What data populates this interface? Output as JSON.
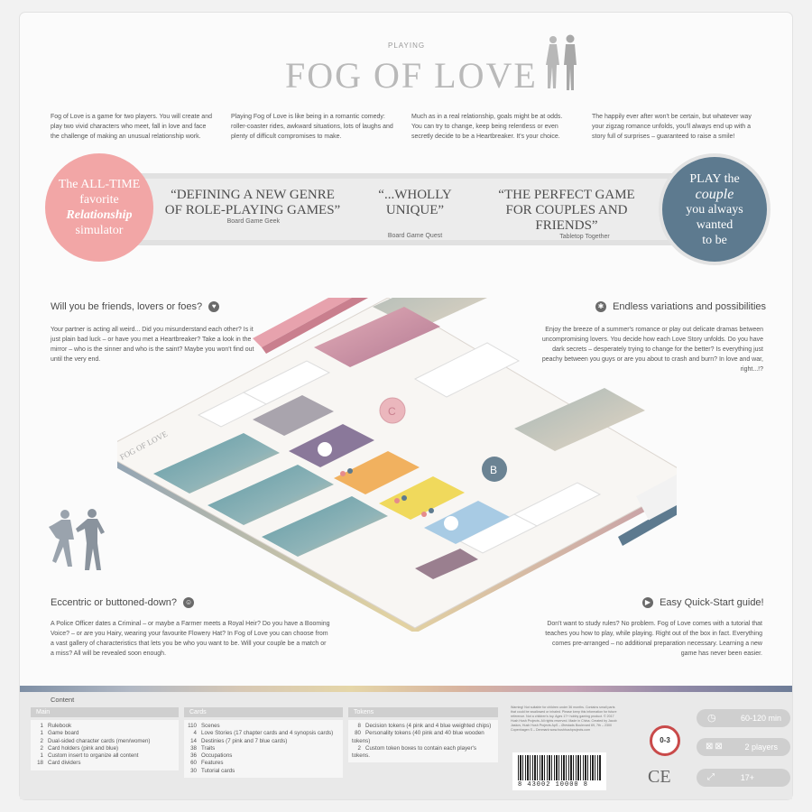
{
  "header": {
    "subtitle": "PLAYING",
    "title": "FOG OF LOVE"
  },
  "intro": [
    "Fog of Love is a game for two players. You will create and play two vivid characters who meet, fall in love and face the challenge of making an unusual relationship work.",
    "Playing Fog of Love is like being in a romantic comedy: roller-coaster rides, awkward situations, lots of laughs and plenty of difficult compromises to make.",
    "Much as in a real relationship, goals might be at odds. You can try to change, keep being relentless or even secretly decide to be a Heartbreaker. It's your choice.",
    "The happily ever after won't be certain, but whatever way your zigzag romance unfolds, you'll always end up with a story full of surprises – guaranteed to raise a smile!"
  ],
  "badge_left": {
    "line1": "The ALL-TIME",
    "line2": "favorite",
    "line3": "Relationship",
    "line4": "simulator",
    "color": "#f2a6a6"
  },
  "badge_right": {
    "line1": "PLAY the",
    "line2": "couple",
    "line3": "you always",
    "line4": "wanted",
    "line5": "to be",
    "color": "#5d7a8f"
  },
  "quotes": [
    {
      "text": "“DEFINING A NEW GENRE OF ROLE-PLAYING GAMES”",
      "source": "Board Game Geek"
    },
    {
      "text": "“...WHOLLY UNIQUE”",
      "source": "Board Game Quest"
    },
    {
      "text": "“THE PERFECT GAME FOR COUPLES AND FRIENDS”",
      "source": "Tabletop Together"
    }
  ],
  "sections": {
    "friends": {
      "title": "Will you be friends, lovers or foes?",
      "text": "Your partner is acting all weird... Did you misunderstand each other? Is it just plain bad luck – or have you met a Heartbreaker? Take a look in the mirror – who is the sinner and who is the saint? Maybe you won't find out until the very end."
    },
    "variations": {
      "title": "Endless variations and possibilities",
      "text": "Enjoy the breeze of a summer's romance or play out delicate dramas between uncompromising lovers. You decide how each Love Story unfolds. Do you have dark secrets – desperately trying to change for the better? Is everything just peachy between you guys or are you about to crash and burn? In love and war, right...!?"
    },
    "eccentric": {
      "title": "Eccentric or buttoned-down?",
      "text": "A Police Officer dates a Criminal – or maybe a Farmer meets a Royal Heir? Do you have a Booming Voice? – or are you Hairy, wearing your favourite Flowery Hat? In Fog of Love you can choose from a vast gallery of characteristics that lets you be who you want to be. Will your couple be a match or a miss? All will be revealed soon enough."
    },
    "quickstart": {
      "title": "Easy Quick-Start guide!",
      "text": "Don't want to study rules? No problem. Fog of Love comes with a tutorial that teaches you how to play, while playing. Right out of the box in fact. Everything comes pre-arranged – no additional preparation necessary. Learning a new game has never been easier."
    }
  },
  "content": {
    "heading": "Content",
    "main": {
      "header": "Main",
      "items": [
        {
          "n": "1",
          "label": "Rulebook"
        },
        {
          "n": "1",
          "label": "Game board"
        },
        {
          "n": "2",
          "label": "Dual-sided character cards (men/women)"
        },
        {
          "n": "2",
          "label": "Card holders (pink and blue)"
        },
        {
          "n": "1",
          "label": "Custom insert to organize all content"
        },
        {
          "n": "18",
          "label": "Card dividers"
        }
      ]
    },
    "cards": {
      "header": "Cards",
      "items": [
        {
          "n": "110",
          "label": "Scenes"
        },
        {
          "n": "4",
          "label": "Love Stories (17 chapter cards and 4 synopsis cards)"
        },
        {
          "n": "14",
          "label": "Destinies (7 pink and 7 blue cards)"
        },
        {
          "n": "38",
          "label": "Traits"
        },
        {
          "n": "36",
          "label": "Occupations"
        },
        {
          "n": "60",
          "label": "Features"
        },
        {
          "n": "30",
          "label": "Tutorial cards"
        }
      ]
    },
    "tokens": {
      "header": "Tokens",
      "items": [
        {
          "n": "8",
          "label": "Decision tokens (4 pink and 4 blue weighted chips)"
        },
        {
          "n": "80",
          "label": "Personality tokens (40 pink and 40 blue wooden tokens)"
        },
        {
          "n": "2",
          "label": "Custom token boxes to contain each player's tokens."
        }
      ]
    }
  },
  "specs": {
    "time": "60-120 min",
    "players": "2 players",
    "age": "17+"
  },
  "legal": {
    "warning": "Warning! Not suitable for children under 36 months. Contains small parts that could be swallowed or inhaled. Please keep this information for future reference. Not a children's toy. Ages 17+ hobby gaming product. © 2017 Hush Hush Projects. All rights reserved. Made in China. Created by Jacob Jaskov, Hush Hush Projects ApS – Ørestads Boulevard 69, 7th – 2300 Copenhagen S – Denmark www.hushhushprojects.com",
    "barcode": "8 43002 10000 8",
    "age_mark": "0-3",
    "ce": "CE"
  },
  "board": {
    "logo": "FOG OF LOVE",
    "token_letters": [
      "C",
      "B"
    ]
  }
}
